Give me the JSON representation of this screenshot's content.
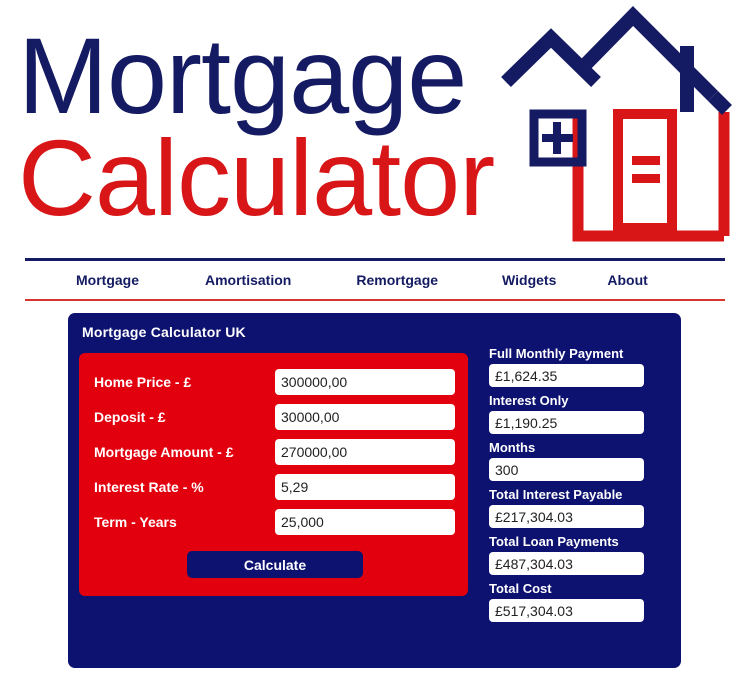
{
  "logo": {
    "line1": "Mortgage",
    "line2": "Calculator",
    "line1_color": "#141b63",
    "line2_color": "#d81618",
    "house_icon": "house-with-window-and-door-icon"
  },
  "nav": {
    "items": [
      {
        "label": "Mortgage"
      },
      {
        "label": "Amortisation"
      },
      {
        "label": "Remortgage"
      },
      {
        "label": "Widgets"
      },
      {
        "label": "About"
      }
    ],
    "rule_top_color": "#141b63",
    "rule_bottom_color": "#d8352f"
  },
  "calculator": {
    "title": "Mortgage Calculator UK",
    "panel_color": "#0d1170",
    "form_color": "#e2000e",
    "fields": [
      {
        "label": "Home Price - £",
        "value": "300000,00"
      },
      {
        "label": "Deposit - £",
        "value": "30000,00"
      },
      {
        "label": "Mortgage Amount - £",
        "value": "270000,00"
      },
      {
        "label": "Interest Rate - %",
        "value": "5,29"
      },
      {
        "label": "Term - Years",
        "value": "25,000"
      }
    ],
    "calculate_label": "Calculate",
    "results": [
      {
        "label": "Full Monthly Payment",
        "value": "£1,624.35"
      },
      {
        "label": "Interest Only",
        "value": "£1,190.25"
      },
      {
        "label": "Months",
        "value": "300"
      },
      {
        "label": "Total Interest Payable",
        "value": "£217,304.03"
      },
      {
        "label": "Total Loan Payments",
        "value": "£487,304.03"
      },
      {
        "label": "Total Cost",
        "value": "£517,304.03"
      }
    ]
  }
}
